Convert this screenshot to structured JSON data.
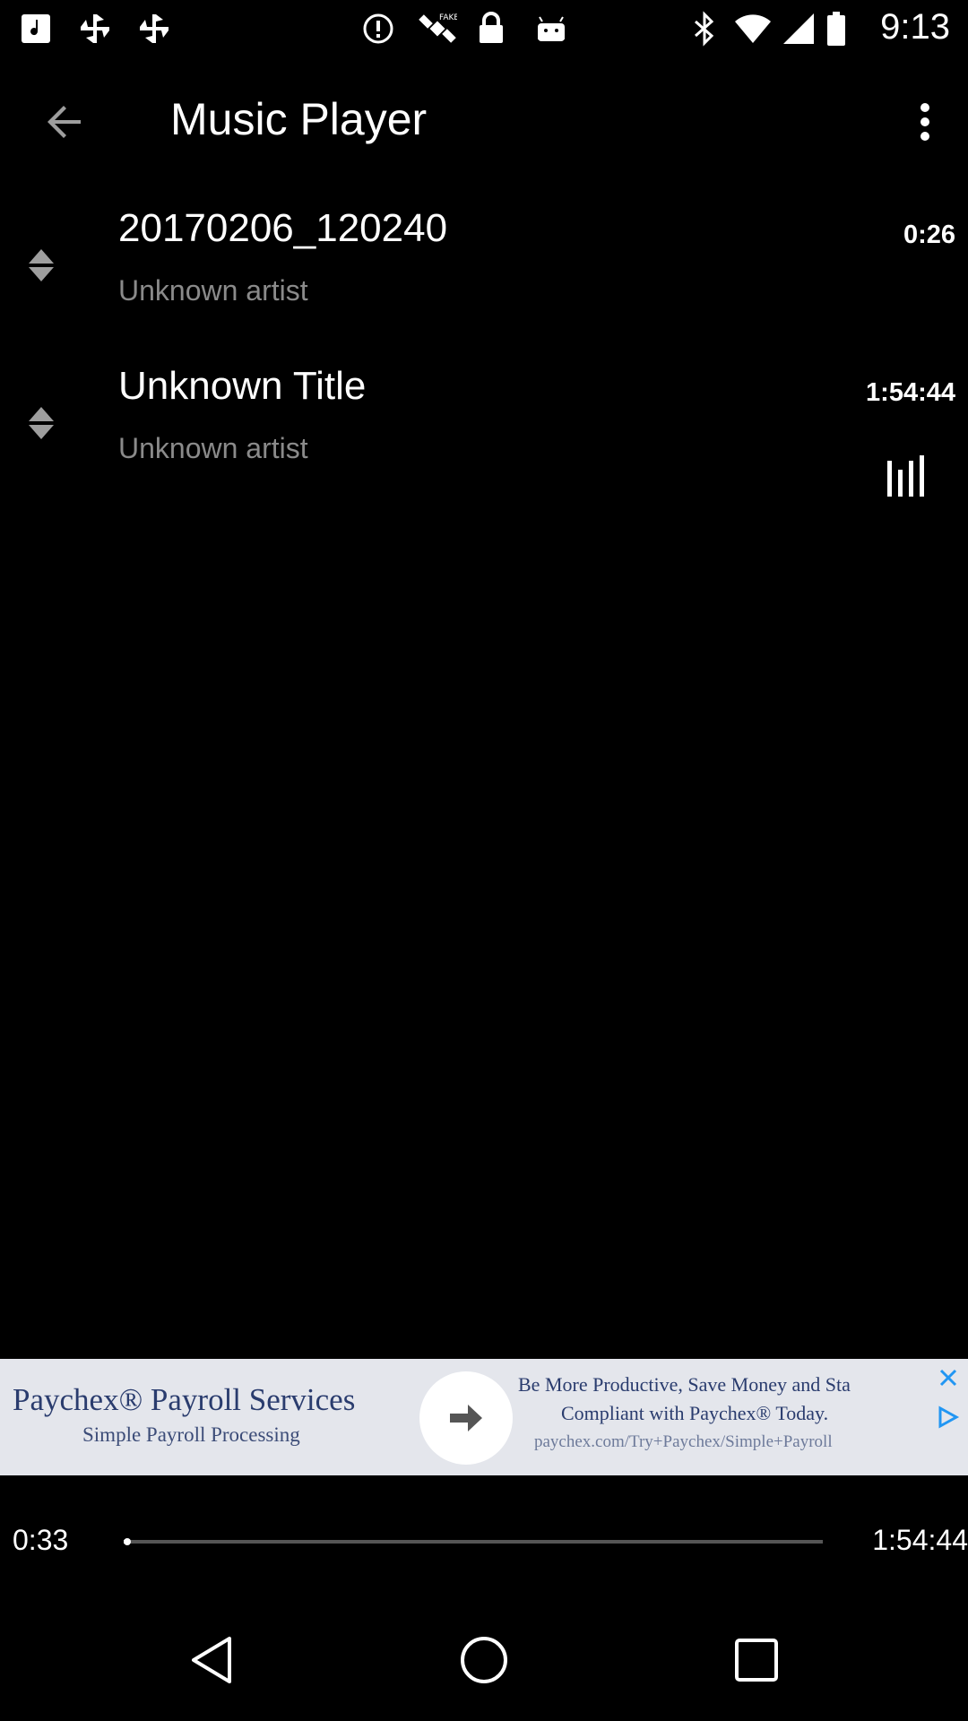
{
  "status_bar": {
    "time": "9:13",
    "left_icons": [
      "music-note-icon",
      "fan-icon",
      "fan-icon",
      "alert-icon",
      "satellite-icon",
      "lock-icon",
      "android-icon"
    ],
    "right_icons": [
      "bluetooth-icon",
      "wifi-icon",
      "signal-icon",
      "battery-icon"
    ]
  },
  "app_bar": {
    "title": "Music Player",
    "back_icon": "arrow-back-icon",
    "menu_icon": "more-vert-icon"
  },
  "tracks": [
    {
      "title": "20170206_120240",
      "artist": "Unknown artist",
      "duration": "0:26",
      "playing": false
    },
    {
      "title": "Unknown Title",
      "artist": "Unknown artist",
      "duration": "1:54:44",
      "playing": true
    }
  ],
  "ad": {
    "left_title": "Paychex® Payroll Services",
    "left_subtitle": "Simple Payroll Processing",
    "right_line1": "Be More Productive, Save Money and Sta",
    "right_line2": "Compliant with Paychex® Today.",
    "right_url": "paychex.com/Try+Paychex/Simple+Payroll",
    "colors": {
      "background": "#e4e6ec",
      "text": "#2a3c6e",
      "adchoices": "#2196f3"
    }
  },
  "player": {
    "elapsed": "0:33",
    "total": "1:54:44",
    "progress_fraction": 0.005
  },
  "nav_bar": {
    "back_icon": "nav-back-icon",
    "home_icon": "nav-home-icon",
    "recents_icon": "nav-recents-icon"
  }
}
